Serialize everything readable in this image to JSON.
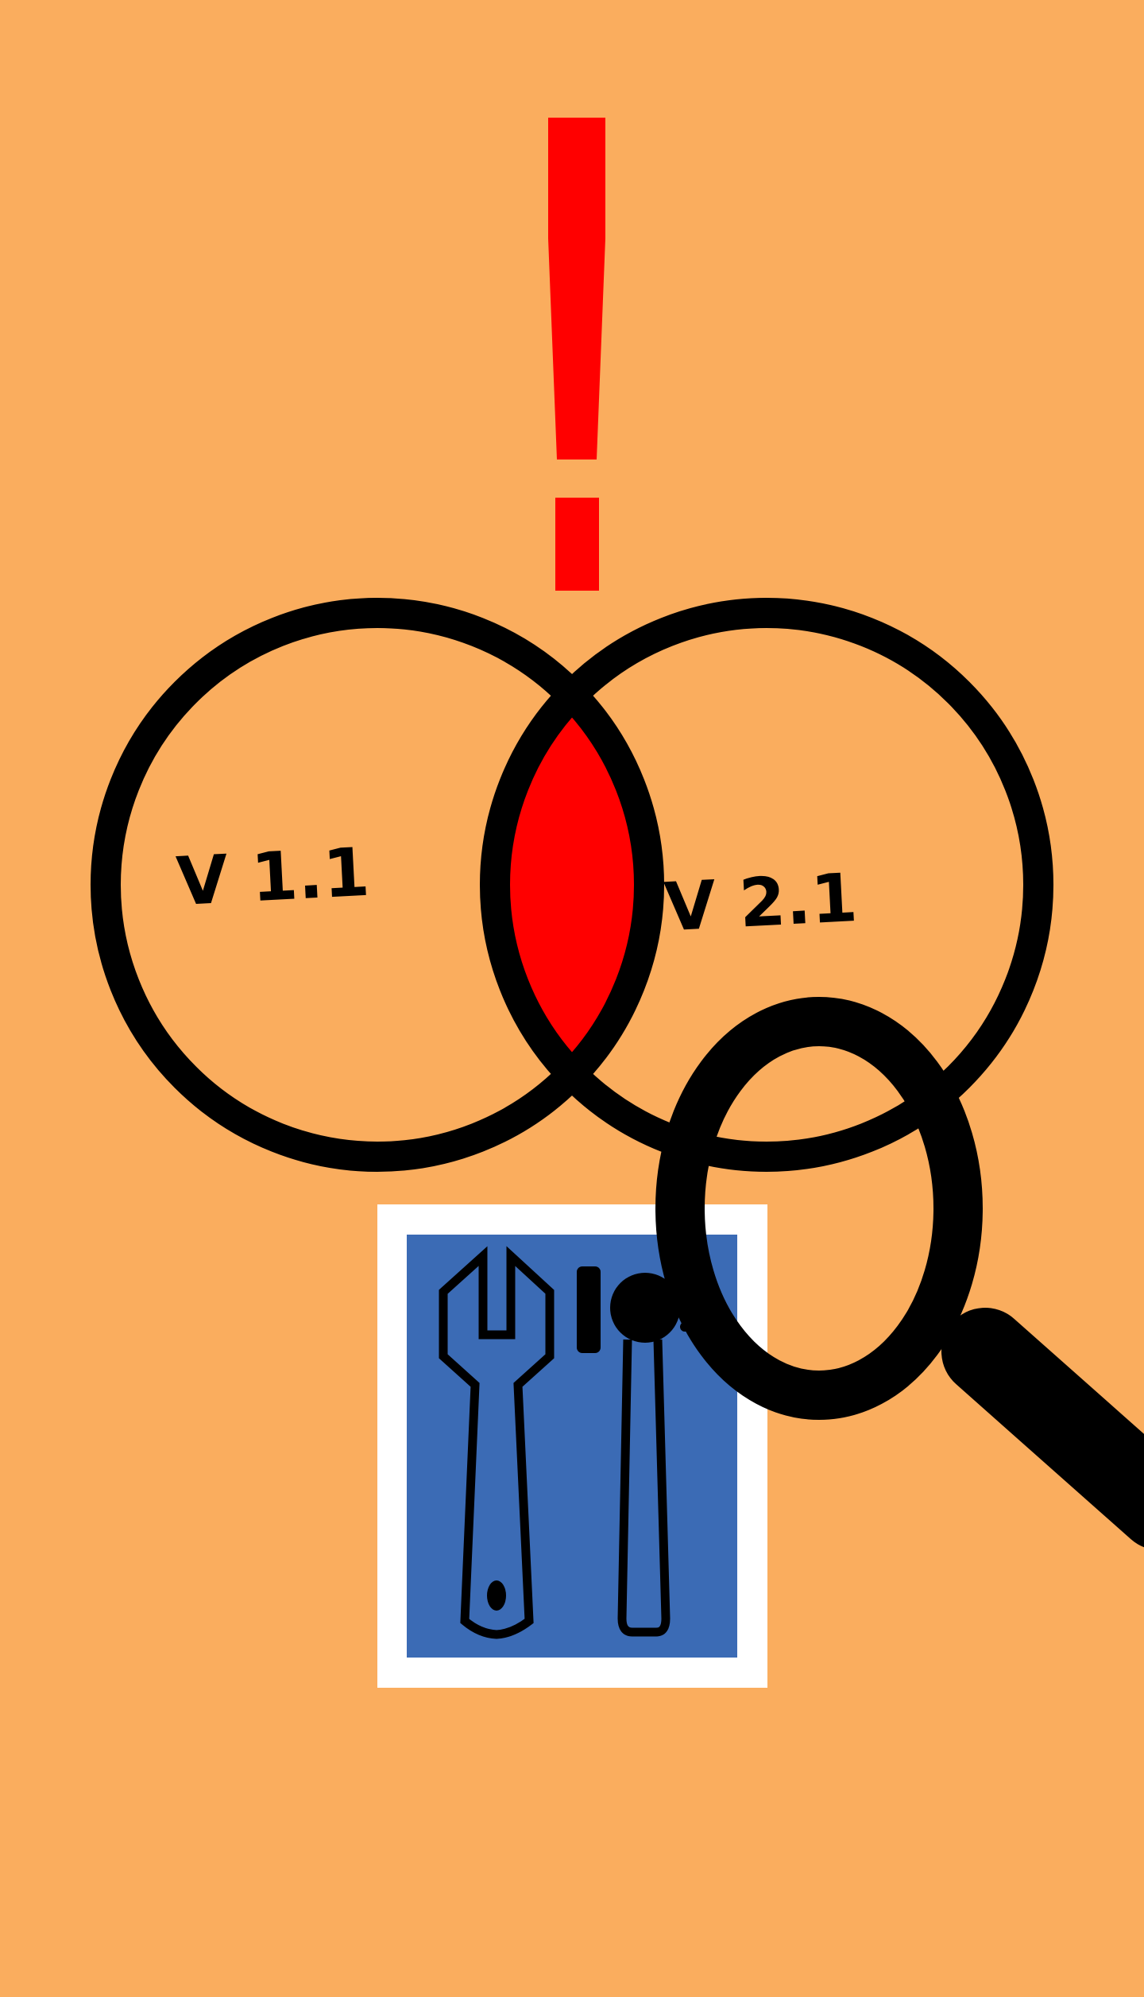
{
  "colors": {
    "background": "#FAAD5E",
    "alert": "#FF0000",
    "outline": "#000000",
    "overlap": "#FF0000",
    "tool_panel": "#3B6BB5",
    "tool_panel_border": "#FFFFFF"
  },
  "labels": {
    "left_version": "V 1.1",
    "right_version": "V 2.1"
  },
  "icons": {
    "alert": "exclamation-icon",
    "tools": "wrench-and-screwdriver-icon",
    "search": "magnifying-glass-icon"
  }
}
